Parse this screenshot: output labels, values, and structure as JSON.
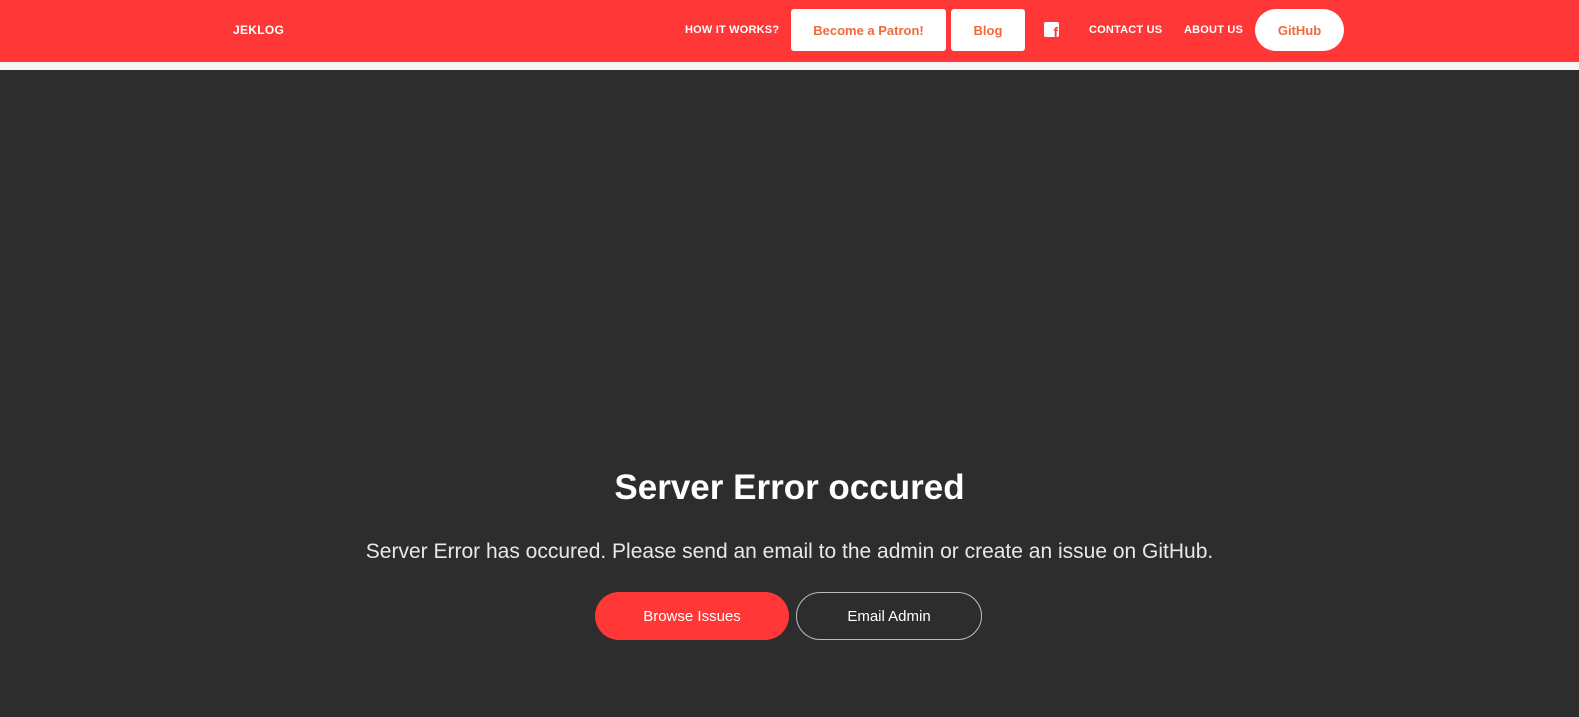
{
  "colors": {
    "brand": "#ff3737",
    "background": "#2d2d2d",
    "button_text": "#f06a3a"
  },
  "navbar": {
    "brand": "JEKLOG",
    "how_it_works": "HOW IT WORKS?",
    "become_patron": "Become a Patron!",
    "blog": "Blog",
    "facebook_icon": "facebook-icon",
    "contact_us": "CONTACT US",
    "about_us": "ABOUT US",
    "github": "GitHub"
  },
  "main": {
    "title": "Server Error occured",
    "message": "Server Error has occured. Please send an email to the admin or create an issue on GitHub.",
    "browse_issues": "Browse Issues",
    "email_admin": "Email Admin"
  }
}
